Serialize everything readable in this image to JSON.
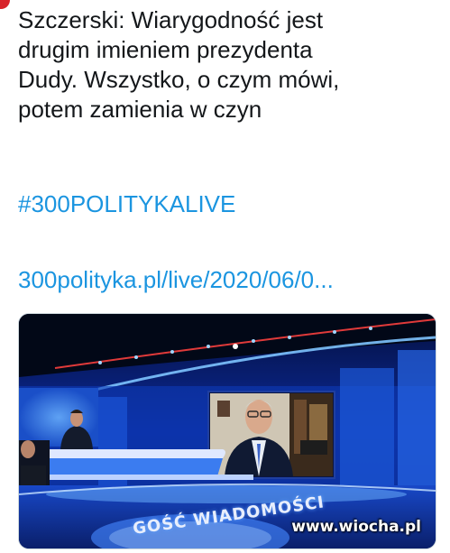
{
  "tweet": {
    "text": "Szczerski: Wiarygodność jest\ndrugim imieniem prezydenta\nDudy. Wszystko, o czym mówi,\npotem zamienia w czyn",
    "hashtag": "#300POLITYKALIVE",
    "link": "300polityka.pl/live/2020/06/0..."
  },
  "media": {
    "banner_text": "GOŚĆ WIADOMOŚCI"
  },
  "watermark": "www.wiocha.pl",
  "colors": {
    "text": "#14171a",
    "link": "#1b95e0",
    "avatar_accent": "#d8232a"
  }
}
